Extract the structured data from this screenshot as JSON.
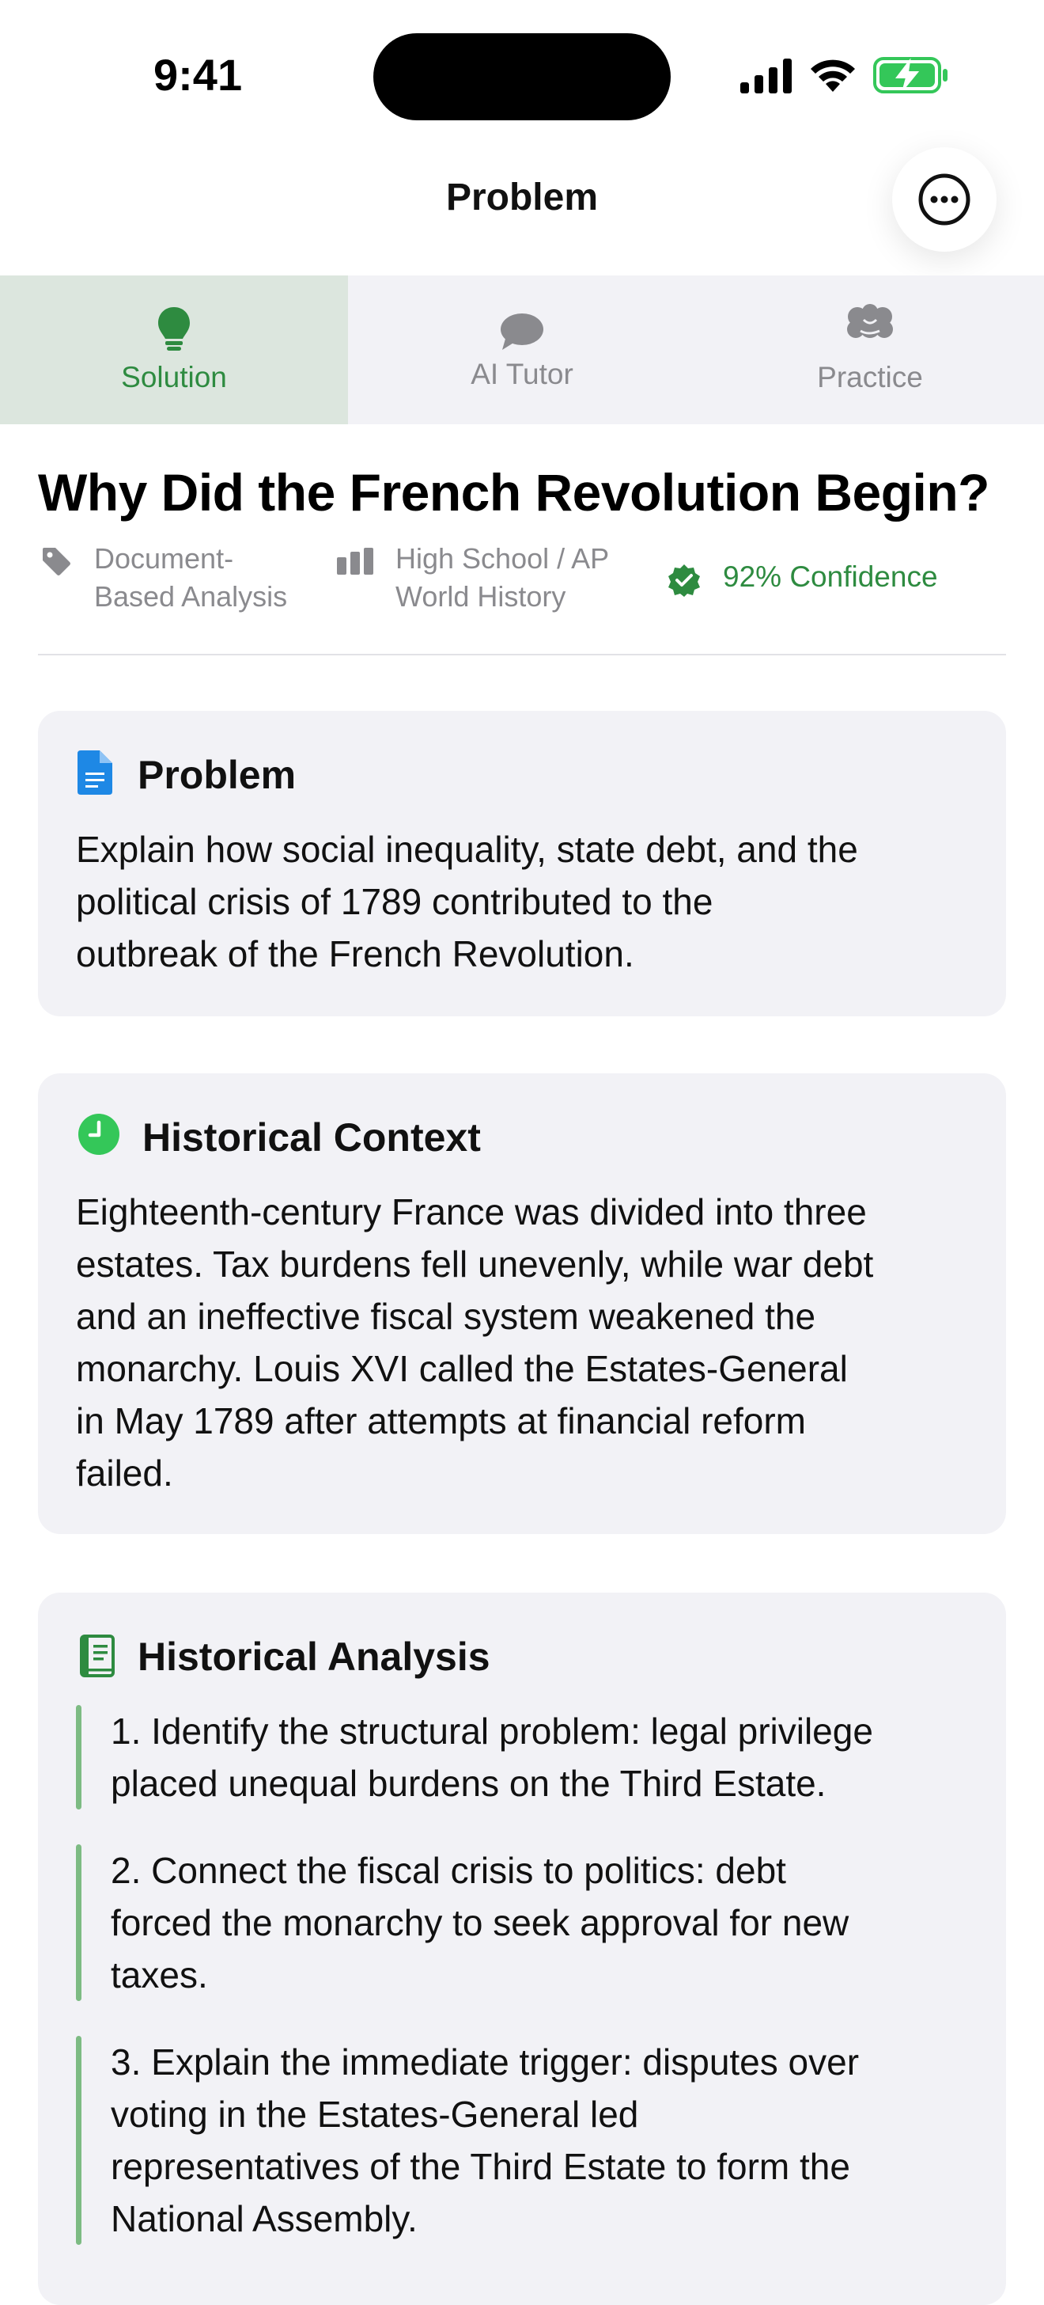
{
  "status_bar": {
    "time": "9:41"
  },
  "nav": {
    "title": "Problem"
  },
  "tabs": [
    {
      "label": "Solution",
      "icon": "lightbulb-icon",
      "active": true
    },
    {
      "label": "AI Tutor",
      "icon": "chat-bubble-icon",
      "active": false
    },
    {
      "label": "Practice",
      "icon": "brain-icon",
      "active": false
    }
  ],
  "header": {
    "title": "Why Did the French Revolution Begin?",
    "meta": [
      {
        "icon": "tag-icon",
        "line1": "Document-",
        "line2": "Based Analysis"
      },
      {
        "icon": "chart-bars-icon",
        "line1": "High School / AP",
        "line2": "World History"
      }
    ],
    "confidence": "92% Confidence"
  },
  "cards": {
    "problem": {
      "title": "Problem",
      "icon": "document-icon",
      "lines": [
        "Explain how social inequality, state debt, and the",
        "political crisis of 1789 contributed to the",
        "outbreak of the French Revolution."
      ]
    },
    "context": {
      "title": "Historical Context",
      "icon": "clock-icon",
      "lines": [
        "Eighteenth-century France was divided into three",
        "estates. Tax burdens fell unevenly, while war debt",
        "and an ineffective fiscal system weakened the",
        "monarchy. Louis XVI called the Estates-General",
        "in May 1789 after attempts at financial reform",
        "failed."
      ]
    },
    "analysis": {
      "title": "Historical Analysis",
      "icon": "book-icon",
      "steps": [
        [
          "1. Identify the structural problem: legal privilege",
          "placed unequal burdens on the Third Estate."
        ],
        [
          "2. Connect the fiscal crisis to politics: debt",
          "forced the monarchy to seek approval for new",
          "taxes."
        ],
        [
          "3. Explain the immediate trigger: disputes over",
          "voting in the Estates-General led",
          "representatives of the Third Estate to form the",
          "National Assembly."
        ]
      ]
    }
  },
  "colors": {
    "accent": "#2e8b40",
    "card_bg": "#f2f2f6",
    "step_bar": "#7dbb83",
    "doc_blue": "#1e88e5"
  }
}
